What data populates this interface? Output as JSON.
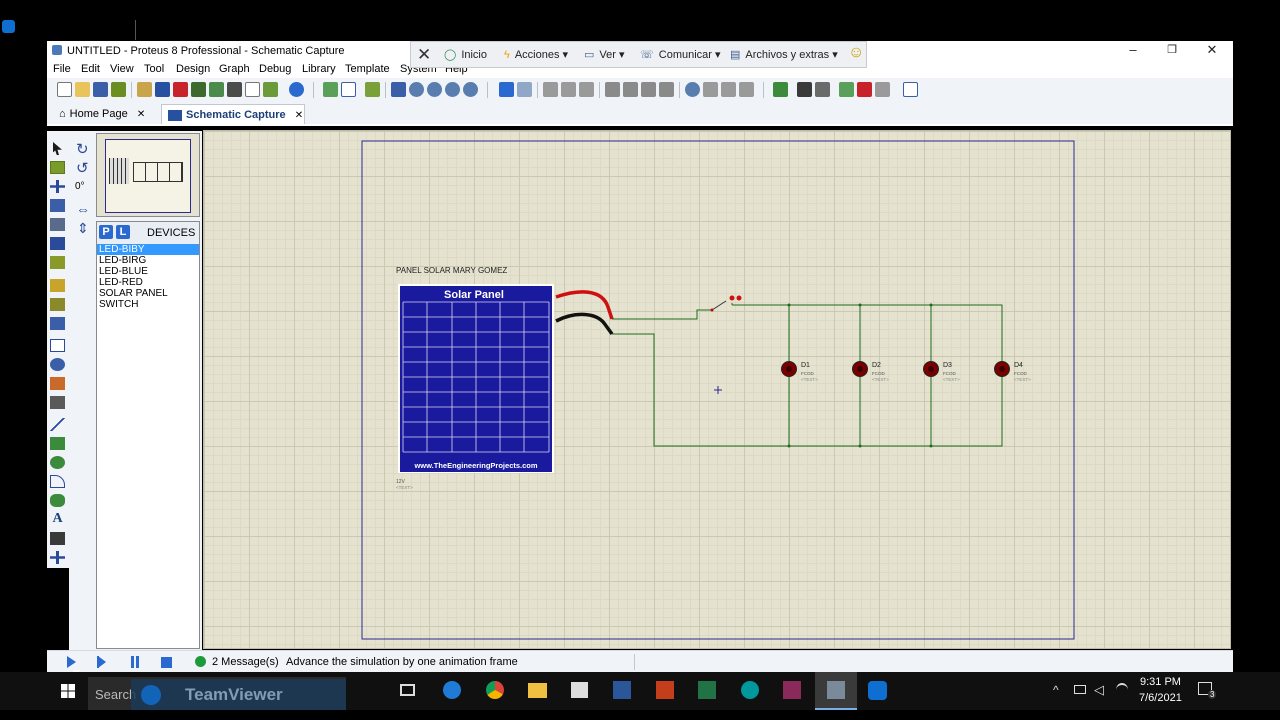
{
  "window": {
    "title": "UNTITLED - Proteus 8 Professional - Schematic Capture",
    "minimize": "–",
    "restore": "❐",
    "close": "✕"
  },
  "teamviewer_bar": {
    "close_glyph": "✕",
    "items": [
      "Inicio",
      "Acciones",
      "Ver",
      "Comunicar",
      "Archivos y extras"
    ],
    "smiley": "☺"
  },
  "menu": [
    "File",
    "Edit",
    "View",
    "Tool",
    "Design",
    "Graph",
    "Debug",
    "Library",
    "Template",
    "System",
    "Help"
  ],
  "tabs": [
    {
      "label": "Home Page",
      "close": "✕"
    },
    {
      "label": "Schematic Capture",
      "close": "✕"
    }
  ],
  "rotation": "0°",
  "devices": {
    "p_label": "P",
    "l_label": "L",
    "header": "DEVICES",
    "items": [
      "LED-BIBY",
      "LED-BIRG",
      "LED-BLUE",
      "LED-RED",
      "SOLAR PANEL",
      "SWITCH"
    ],
    "selected_index": 0
  },
  "schematic": {
    "title_label": "PANEL SOLAR MARY GOMEZ",
    "panel_title": "Solar Panel",
    "panel_url": "www.TheEngineeringProjects.com",
    "panel_value": "12V",
    "panel_text": "<TEXT>",
    "leds": [
      {
        "ref": "D1",
        "value": "FCOD",
        "text": "<TEXT>"
      },
      {
        "ref": "D2",
        "value": "FCOD",
        "text": "<TEXT>"
      },
      {
        "ref": "D3",
        "value": "FCOD",
        "text": "<TEXT>"
      },
      {
        "ref": "D4",
        "value": "FCOD",
        "text": "<TEXT>"
      }
    ]
  },
  "status": {
    "messages": "2 Message(s)",
    "hint": "Advance the simulation by one animation frame"
  },
  "taskbar": {
    "search_placeholder": "Search",
    "teamviewer_label": "TeamViewer",
    "time": "9:31 PM",
    "date": "7/6/2021",
    "notifications": "3"
  },
  "colors": {
    "accent": "#3399ff",
    "panel_blue": "#1a1a9e",
    "wire": "#1f6b1f",
    "led": "#7a0000",
    "sheet_border": "#2a2a90"
  }
}
